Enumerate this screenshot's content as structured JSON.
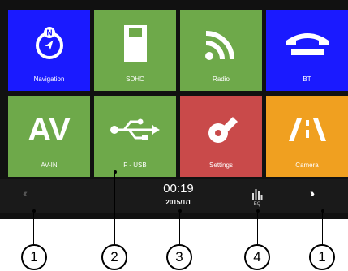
{
  "tiles": [
    {
      "label": "Navigation",
      "color": "#1a1aff",
      "icon": "compass-icon"
    },
    {
      "label": "SDHC",
      "color": "#6ea94a",
      "icon": "sd-card-icon"
    },
    {
      "label": "Radio",
      "color": "#6ea94a",
      "icon": "radio-waves-icon"
    },
    {
      "label": "BT",
      "color": "#1a1aff",
      "icon": "phone-handset-icon"
    },
    {
      "label": "AV-IN",
      "color": "#6ea94a",
      "icon": "av-icon",
      "glyph": "AV"
    },
    {
      "label": "F - USB",
      "color": "#6ea94a",
      "icon": "usb-icon"
    },
    {
      "label": "Settings",
      "color": "#c94a4a",
      "icon": "wrench-icon"
    },
    {
      "label": "Camera",
      "color": "#f0a020",
      "icon": "road-icon"
    }
  ],
  "status": {
    "time": "00:19",
    "date": "2015/1/1",
    "eq_label": "EQ"
  },
  "nav": {
    "prev": "‹‹‹",
    "next": "›››"
  },
  "callouts": [
    "1",
    "2",
    "3",
    "4",
    "1"
  ]
}
